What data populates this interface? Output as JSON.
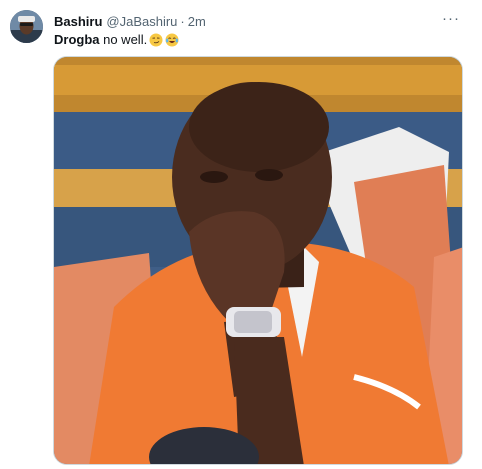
{
  "tweet": {
    "author_name": "Bashiru",
    "author_handle": "@JaBashiru",
    "separator": "·",
    "time": "2m",
    "more_label": "···",
    "text_bold": "Drogba",
    "text_rest": " no well.",
    "emojis": [
      "smirking-face",
      "face-with-tears-of-joy"
    ],
    "media_alt": "Man in orange jersey resting chin on hand in stadium seats"
  },
  "colors": {
    "text_primary": "#0f1419",
    "text_secondary": "#536471",
    "border": "#cfd9de"
  }
}
